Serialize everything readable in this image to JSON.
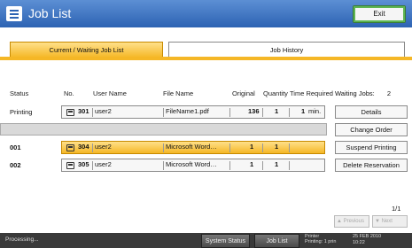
{
  "window": {
    "title": "Job List",
    "exit_label": "Exit"
  },
  "tabs": [
    {
      "label": "Current / Waiting Job List",
      "active": true
    },
    {
      "label": "Job History",
      "active": false
    }
  ],
  "columns": {
    "status": "Status",
    "no": "No.",
    "user_name": "User Name",
    "file_name": "File Name",
    "original": "Original",
    "quantity": "Quantity",
    "time_required": "Time Required"
  },
  "waiting_jobs": {
    "label": "Waiting Jobs:",
    "count": "2"
  },
  "jobs": [
    {
      "status": "Printing",
      "no": "301",
      "user": "user2",
      "file": "FileName1.pdf",
      "original": "136",
      "quantity": "1",
      "time": "1",
      "time_unit": "min.",
      "selected": false
    },
    {
      "status": "001",
      "no": "304",
      "user": "user2",
      "file": "Microsoft Word…",
      "original": "1",
      "quantity": "1",
      "time": "",
      "time_unit": "",
      "selected": true
    },
    {
      "status": "002",
      "no": "305",
      "user": "user2",
      "file": "Microsoft Word…",
      "original": "1",
      "quantity": "1",
      "time": "",
      "time_unit": "",
      "selected": false
    }
  ],
  "side_buttons": {
    "details": "Details",
    "change_order": "Change Order",
    "suspend": "Suspend Printing",
    "delete": "Delete Reservation"
  },
  "pager": {
    "page": "1/1",
    "previous": "Previous",
    "next": "Next"
  },
  "statusbar": {
    "left": "Processing...",
    "system_status": "System Status",
    "job_list": "Job List",
    "mode_line1": "Printer",
    "mode_line2": "Printing: 1 prin",
    "date": "25 FEB  2010",
    "time": "10:22"
  },
  "colors": {
    "title_bar": "#2d63b3",
    "tab_active": "#f5b726",
    "exit_border": "#5db552"
  },
  "icons": [
    "list-icon",
    "printer-icon",
    "triangle-up-icon",
    "triangle-down-icon"
  ]
}
